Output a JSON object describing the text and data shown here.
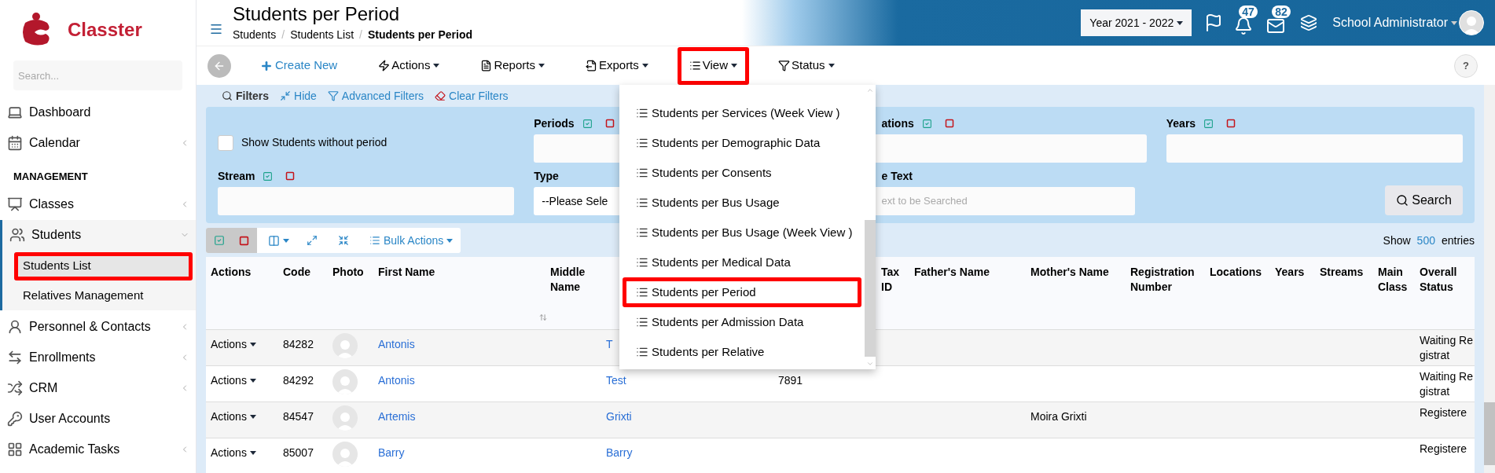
{
  "brand": {
    "name": "Classter"
  },
  "sidebar": {
    "search_placeholder": "Search...",
    "items": [
      {
        "kind": "item",
        "label": "Dashboard",
        "has_submenu": false,
        "expanded": false
      },
      {
        "kind": "item",
        "label": "Calendar",
        "has_submenu": true,
        "expanded": false
      },
      {
        "kind": "heading",
        "label": "MANAGEMENT"
      },
      {
        "kind": "item",
        "label": "Classes",
        "has_submenu": true,
        "expanded": false
      },
      {
        "kind": "item",
        "label": "Students",
        "has_submenu": true,
        "expanded": true,
        "children": [
          {
            "label": "Students List",
            "selected": true,
            "annotated": true
          },
          {
            "label": "Relatives Management",
            "selected": false,
            "annotated": false
          }
        ]
      },
      {
        "kind": "item",
        "label": "Personnel & Contacts",
        "has_submenu": true,
        "expanded": false
      },
      {
        "kind": "item",
        "label": "Enrollments",
        "has_submenu": true,
        "expanded": false
      },
      {
        "kind": "item",
        "label": "CRM",
        "has_submenu": true,
        "expanded": false
      },
      {
        "kind": "item",
        "label": "User Accounts",
        "has_submenu": false,
        "expanded": false
      },
      {
        "kind": "item",
        "label": "Academic Tasks",
        "has_submenu": true,
        "expanded": false
      }
    ]
  },
  "header": {
    "title": "Students per Period",
    "separator": "/",
    "breadcrumbs": [
      {
        "label": "Students",
        "current": false
      },
      {
        "label": "Students List",
        "current": false
      },
      {
        "label": "Students per Period",
        "current": true
      }
    ],
    "year": "Year 2021 - 2022",
    "notifications": "47",
    "messages": "82",
    "user": "School Administrator"
  },
  "toolbar": [
    {
      "kind": "primary",
      "label": "Create New",
      "annotated": false
    },
    {
      "kind": "menu",
      "label": "Actions",
      "annotated": false
    },
    {
      "kind": "menu",
      "label": "Reports",
      "annotated": false
    },
    {
      "kind": "menu",
      "label": "Exports",
      "annotated": false
    },
    {
      "kind": "menu",
      "label": "View",
      "annotated": true
    },
    {
      "kind": "menu",
      "label": "Status",
      "annotated": false
    }
  ],
  "help": "?",
  "filters": {
    "links": [
      {
        "label": "Filters"
      },
      {
        "label": "Hide"
      },
      {
        "label": "Advanced Filters"
      },
      {
        "label": "Clear Filters"
      }
    ],
    "fields": [
      {
        "kind": "checkbox",
        "label": "Show Students without period",
        "checked": false
      },
      {
        "kind": "multiselect",
        "label": "Periods"
      },
      {
        "kind": "multiselect",
        "label": "ations"
      },
      {
        "kind": "multiselect",
        "label": "Years"
      },
      {
        "kind": "multiselect",
        "label": "Stream"
      },
      {
        "kind": "select",
        "label": "Type",
        "value": "--Please Sele"
      },
      {
        "kind": "text",
        "label": "e Text",
        "placeholder": "ext to be Searched"
      }
    ],
    "search_button": "Search"
  },
  "table_tools": {
    "bulk_actions": "Bulk Actions",
    "show": "Show",
    "page_size": "500",
    "entries": "entries"
  },
  "view_menu": {
    "items": [
      {
        "label": "Students per Services (Week View )",
        "annotated": false
      },
      {
        "label": "Students per Demographic Data",
        "annotated": false
      },
      {
        "label": "Students per Consents",
        "annotated": false
      },
      {
        "label": "Students per Bus Usage",
        "annotated": false
      },
      {
        "label": "Students per Bus Usage (Week View )",
        "annotated": false
      },
      {
        "label": "Students per Medical Data",
        "annotated": false
      },
      {
        "label": "Students per Period",
        "annotated": true
      },
      {
        "label": "Students per Admission Data",
        "annotated": false
      },
      {
        "label": "Students per Relative",
        "annotated": false
      }
    ]
  },
  "table": {
    "columns": [
      {
        "kind": "text",
        "label": "Actions"
      },
      {
        "kind": "text",
        "label": "Code"
      },
      {
        "kind": "text",
        "label": "Photo"
      },
      {
        "kind": "text",
        "label": "First Name"
      },
      {
        "kind": "text",
        "label": "Middle Name"
      },
      {
        "kind": "covered"
      },
      {
        "kind": "covered"
      },
      {
        "kind": "text",
        "label": "Tax ID"
      },
      {
        "kind": "text",
        "label": "Father's Name"
      },
      {
        "kind": "text",
        "label": "Mother's Name"
      },
      {
        "kind": "text",
        "label": "Registration Number"
      },
      {
        "kind": "text",
        "label": "Locations"
      },
      {
        "kind": "text",
        "label": "Years"
      },
      {
        "kind": "text",
        "label": "Streams"
      },
      {
        "kind": "text",
        "label": "Main Class"
      },
      {
        "kind": "text",
        "label": "Overall Status"
      }
    ],
    "rows": [
      {
        "actions": "Actions",
        "code": "84282",
        "first_name": "Antonis",
        "last_name": "T",
        "overall_status": "Waiting Registrat"
      },
      {
        "actions": "Actions",
        "code": "84292",
        "first_name": "Antonis",
        "last_name": "Test",
        "column_7": "7891",
        "overall_status": "Waiting Registrat"
      },
      {
        "actions": "Actions",
        "code": "84547",
        "first_name": "Artemis",
        "last_name": "Grixti",
        "mothers_name": "Moira Grixti",
        "overall_status": "Registere"
      },
      {
        "actions": "Actions",
        "code": "85007",
        "first_name": "Barry",
        "last_name": "Barry",
        "overall_status": "Registere"
      }
    ]
  }
}
